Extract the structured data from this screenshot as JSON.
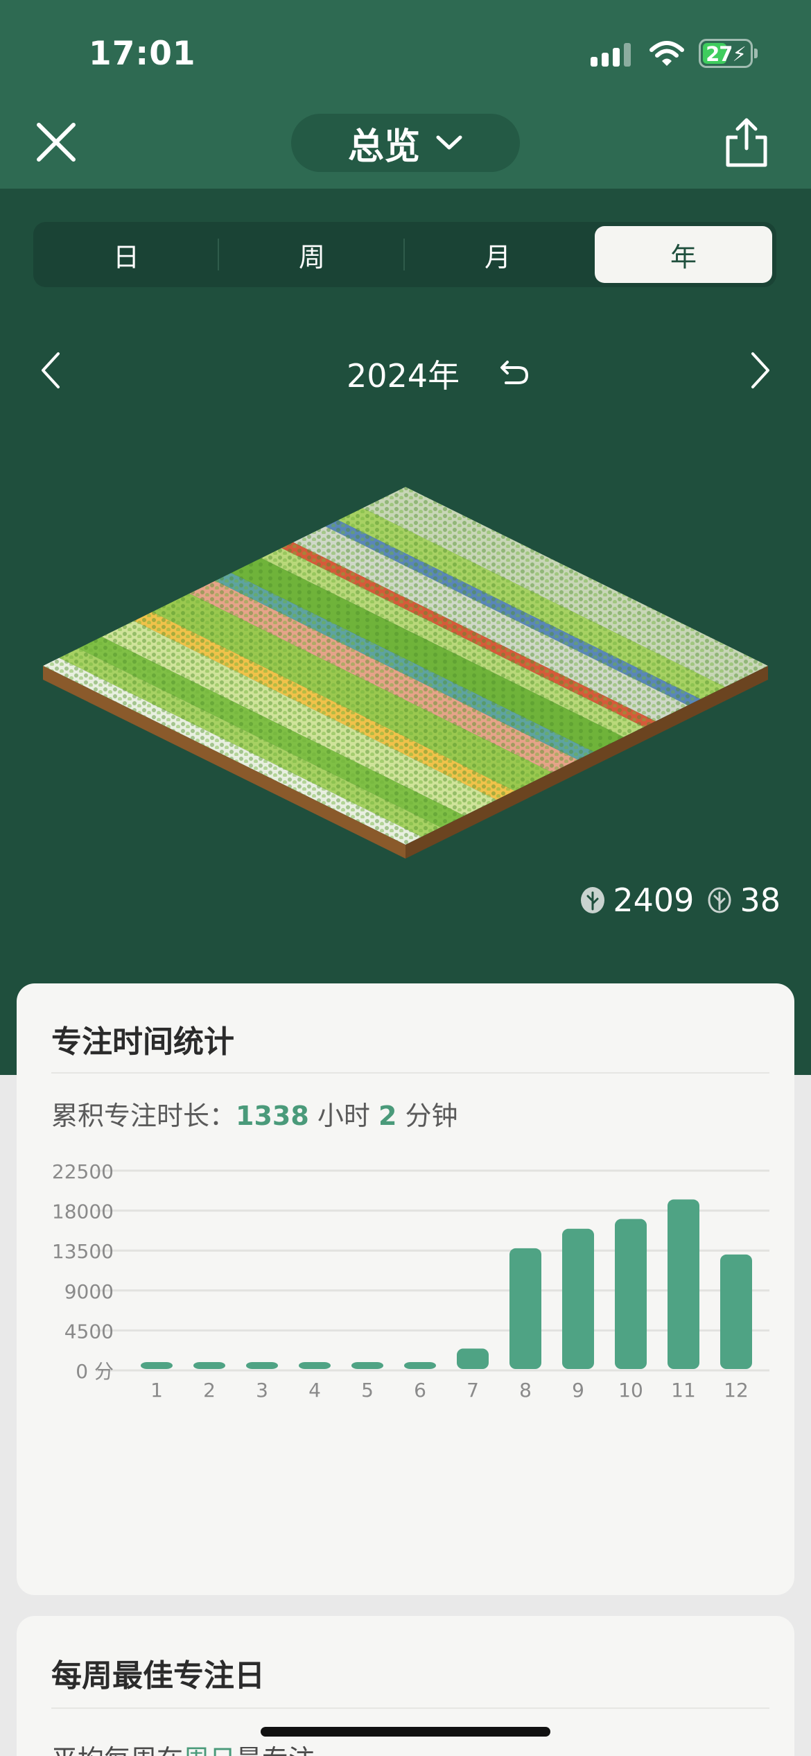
{
  "status_bar": {
    "time": "17:01",
    "battery": "27"
  },
  "header": {
    "title": "总览"
  },
  "segments": {
    "day": "日",
    "week": "周",
    "month": "月",
    "year": "年",
    "active": "year"
  },
  "year_nav": {
    "label": "2024年"
  },
  "counts": {
    "healthy_trees": "2409",
    "dead_trees": "38"
  },
  "focus_card": {
    "title": "专注时间统计",
    "total_prefix": "累积专注时长：",
    "total_hours": "1338",
    "hours_unit": " 小时 ",
    "total_minutes": "2",
    "minutes_unit": " 分钟"
  },
  "chart_data": {
    "type": "bar",
    "categories": [
      "1",
      "2",
      "3",
      "4",
      "5",
      "6",
      "7",
      "8",
      "9",
      "10",
      "11",
      "12"
    ],
    "values": [
      400,
      420,
      420,
      470,
      660,
      740,
      2300,
      13600,
      15800,
      16900,
      19100,
      12900
    ],
    "y_ticks": [
      "0 分",
      "4500",
      "9000",
      "13500",
      "18000",
      "22500"
    ],
    "ylim": [
      0,
      22500
    ],
    "grid": true,
    "color": "#4fa384"
  },
  "weekday_card": {
    "title": "每周最佳专注日",
    "avg_prefix": "平均每周在",
    "avg_day": "周日",
    "avg_suffix": "最专注"
  },
  "colors": {
    "header": "#2e6a52",
    "background": "#1f4f3d",
    "accent": "#4a9a7a"
  }
}
